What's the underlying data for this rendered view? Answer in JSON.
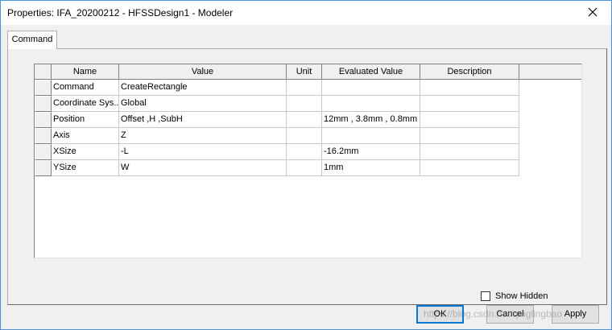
{
  "window": {
    "title": "Properties: IFA_20200212 - HFSSDesign1 - Modeler"
  },
  "tabs": [
    {
      "label": "Command"
    }
  ],
  "grid": {
    "columns": [
      "Name",
      "Value",
      "Unit",
      "Evaluated Value",
      "Description"
    ],
    "rows": [
      {
        "name": "Command",
        "value": "CreateRectangle",
        "unit": "",
        "evaluated": "",
        "description": ""
      },
      {
        "name": "Coordinate Sys...",
        "value": "Global",
        "unit": "",
        "evaluated": "",
        "description": ""
      },
      {
        "name": "Position",
        "value": "Offset ,H ,SubH",
        "unit": "",
        "evaluated": "12mm , 3.8mm , 0.8mm",
        "description": ""
      },
      {
        "name": "Axis",
        "value": "Z",
        "unit": "",
        "evaluated": "",
        "description": ""
      },
      {
        "name": "XSize",
        "value": "-L",
        "unit": "",
        "evaluated": "-16.2mm",
        "description": ""
      },
      {
        "name": "YSize",
        "value": "W",
        "unit": "",
        "evaluated": "1mm",
        "description": ""
      }
    ]
  },
  "options": {
    "show_hidden_label": "Show Hidden",
    "show_hidden_checked": false
  },
  "buttons": {
    "ok": "OK",
    "cancel": "Cancel",
    "apply": "Apply"
  },
  "watermark": "https://blog.csdn.net/qinglingbao",
  "icons": {
    "close": "close-icon"
  }
}
